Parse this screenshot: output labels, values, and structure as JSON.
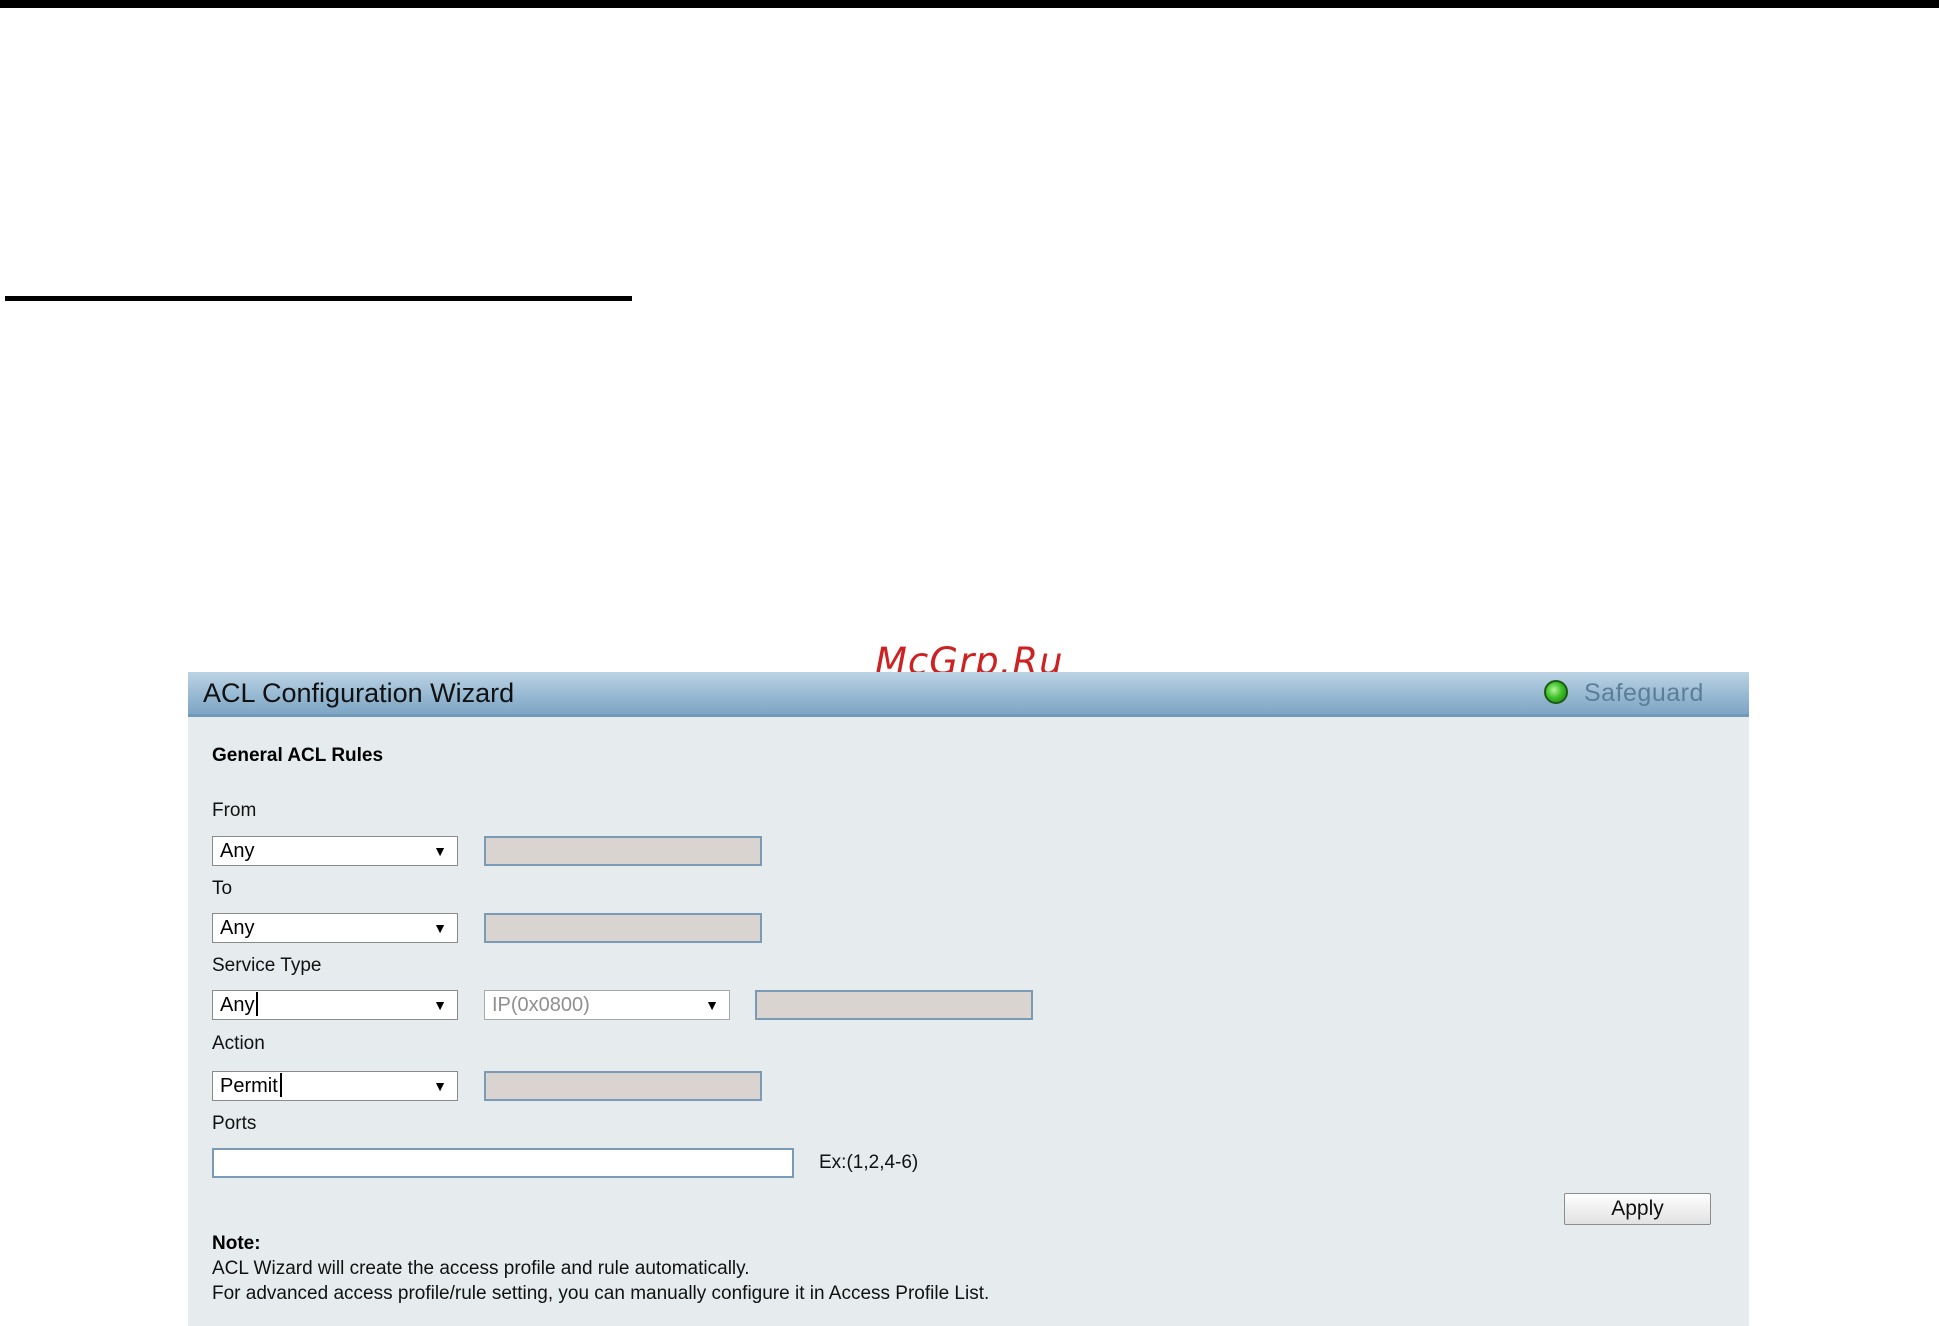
{
  "watermark": "McGrp.Ru",
  "panel": {
    "title": "ACL Configuration Wizard",
    "status_label": "Safeguard",
    "status_color": "#3fc12a"
  },
  "form": {
    "section_title": "General ACL Rules",
    "from": {
      "label": "From",
      "selected": "Any"
    },
    "to": {
      "label": "To",
      "selected": "Any"
    },
    "service_type": {
      "label": "Service Type",
      "selected": "Any",
      "protocol_selected": "IP(0x0800)"
    },
    "action": {
      "label": "Action",
      "selected": "Permit"
    },
    "ports": {
      "label": "Ports",
      "value": "",
      "hint": "Ex:(1,2,4-6)"
    },
    "apply_label": "Apply"
  },
  "note": {
    "title": "Note:",
    "line1": "ACL Wizard will create the access profile and rule automatically.",
    "line2": "For advanced access profile/rule setting, you can manually configure it in Access Profile List."
  }
}
